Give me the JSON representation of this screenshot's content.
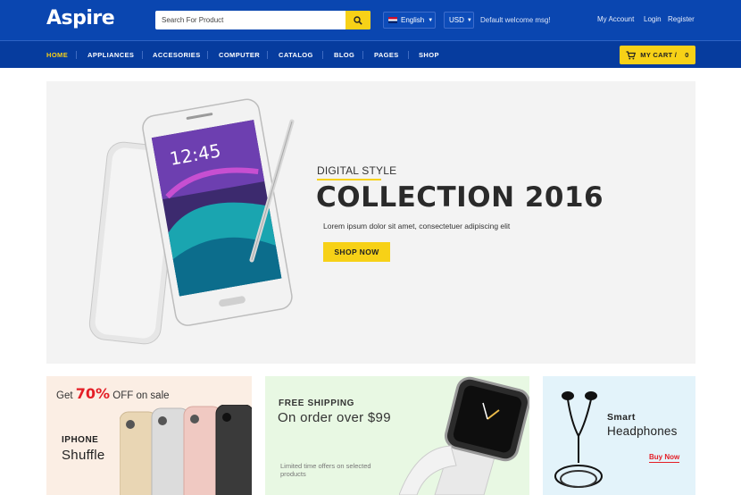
{
  "header": {
    "logo": "Aspire",
    "search_placeholder": "Search For Product",
    "language": "English",
    "currency": "USD",
    "welcome": "Default welcome msg!",
    "links": [
      "My Account",
      "Login",
      "Register"
    ]
  },
  "nav": {
    "items": [
      "HOME",
      "APPLIANCES",
      "ACCESORIES",
      "COMPUTER",
      "CATALOG",
      "BLOG",
      "PAGES",
      "SHOP"
    ],
    "active": "HOME",
    "cart_label": "MY CART /",
    "cart_count": "0"
  },
  "hero": {
    "eyebrow": "DIGITAL STYLE",
    "title": "COLLECTION 2016",
    "description": "Lorem ipsum dolor sit amet, consectetuer adipiscing elit",
    "button": "SHOP NOW",
    "phone_time": "12:45"
  },
  "banners": [
    {
      "prefix": "Get",
      "percent": "70%",
      "suffix": "OFF on sale",
      "small": "IPHONE",
      "big": "Shuffle"
    },
    {
      "small": "FREE SHIPPING",
      "big": "On order over $99",
      "note": "Limited time offers on selected products"
    },
    {
      "small": "Smart",
      "big": "Headphones",
      "link": "Buy Now"
    }
  ],
  "colors": {
    "primary_blue": "#0a46b0",
    "nav_blue": "#063c9e",
    "accent_yellow": "#f7d117",
    "sale_red": "#e41e26"
  }
}
